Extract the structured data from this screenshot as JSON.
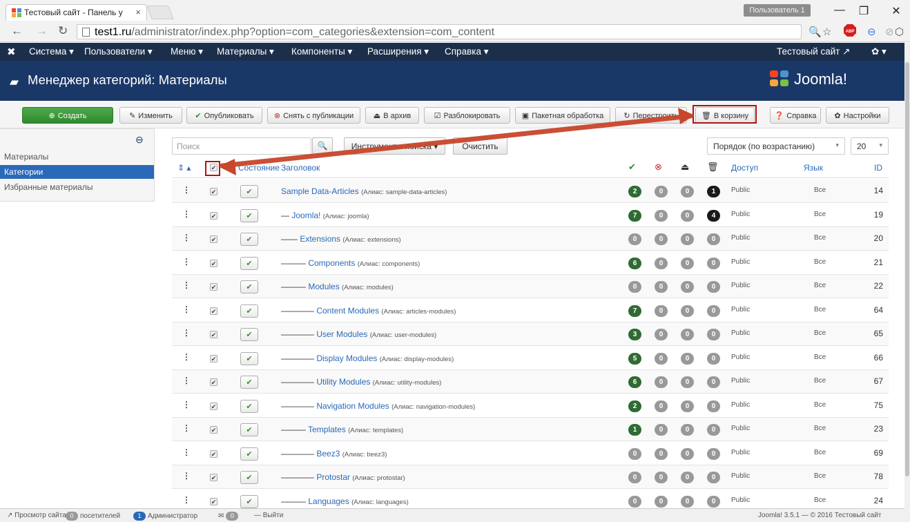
{
  "browser": {
    "tab_title": "Тестовый сайт - Панель у",
    "tab_close": "×",
    "user_badge": "Пользователь 1",
    "window": {
      "minimize": "—",
      "restore": "❐",
      "close": "✕"
    },
    "url_host": "test1.ru",
    "url_path": "/administrator/index.php?option=com_categories&extension=com_content"
  },
  "topnav": {
    "items": [
      "Система ▾",
      "Пользователи ▾",
      "Меню ▾",
      "Материалы ▾",
      "Компоненты ▾",
      "Расширения ▾",
      "Справка ▾"
    ],
    "site_link": "Тестовый сайт ↗",
    "settings": "✿ ▾"
  },
  "header": {
    "title": "Менеджер категорий: Материалы",
    "brand": "Joomla!"
  },
  "toolbar": {
    "create": "Создать",
    "edit": "Изменить",
    "publish": "Опубликовать",
    "unpublish": "Снять с публикации",
    "archive": "В архив",
    "checkin": "Разблокировать",
    "batch": "Пакетная обработка",
    "rebuild": "Перестроить",
    "trash": "В корзину",
    "help": "Справка",
    "options": "Настройки"
  },
  "sidebar": {
    "items": [
      {
        "label": "Материалы",
        "active": false
      },
      {
        "label": "Категории",
        "active": true
      },
      {
        "label": "Избранные материалы",
        "active": false
      }
    ]
  },
  "filters": {
    "search_placeholder": "Поиск",
    "search_tools": "Инструменты поиска ▾",
    "clear": "Очистить",
    "ordering": "Порядок (по возрастанию)",
    "limit": "20"
  },
  "table": {
    "headers": {
      "status": "Состояние",
      "title": "Заголовок",
      "access": "Доступ",
      "language": "Язык",
      "id": "ID"
    },
    "alias_prefix": "Алиас:",
    "rows": [
      {
        "dashes": "",
        "title": "Sample Data-Articles",
        "alias": "sample-data-articles",
        "published": "2",
        "unpublished": "0",
        "archived": "0",
        "trashed": "1",
        "access": "Public",
        "lang": "Все",
        "id": "14"
      },
      {
        "dashes": "—",
        "title": "Joomla!",
        "alias": "joomla",
        "published": "7",
        "unpublished": "0",
        "archived": "0",
        "trashed": "4",
        "access": "Public",
        "lang": "Все",
        "id": "19"
      },
      {
        "dashes": "——",
        "title": "Extensions",
        "alias": "extensions",
        "published": "0",
        "unpublished": "0",
        "archived": "0",
        "trashed": "0",
        "access": "Public",
        "lang": "Все",
        "id": "20"
      },
      {
        "dashes": "———",
        "title": "Components",
        "alias": "components",
        "published": "6",
        "unpublished": "0",
        "archived": "0",
        "trashed": "0",
        "access": "Public",
        "lang": "Все",
        "id": "21"
      },
      {
        "dashes": "———",
        "title": "Modules",
        "alias": "modules",
        "published": "0",
        "unpublished": "0",
        "archived": "0",
        "trashed": "0",
        "access": "Public",
        "lang": "Все",
        "id": "22"
      },
      {
        "dashes": "————",
        "title": "Content Modules",
        "alias": "articles-modules",
        "published": "7",
        "unpublished": "0",
        "archived": "0",
        "trashed": "0",
        "access": "Public",
        "lang": "Все",
        "id": "64"
      },
      {
        "dashes": "————",
        "title": "User Modules",
        "alias": "user-modules",
        "published": "3",
        "unpublished": "0",
        "archived": "0",
        "trashed": "0",
        "access": "Public",
        "lang": "Все",
        "id": "65"
      },
      {
        "dashes": "————",
        "title": "Display Modules",
        "alias": "display-modules",
        "published": "5",
        "unpublished": "0",
        "archived": "0",
        "trashed": "0",
        "access": "Public",
        "lang": "Все",
        "id": "66"
      },
      {
        "dashes": "————",
        "title": "Utility Modules",
        "alias": "utility-modules",
        "published": "6",
        "unpublished": "0",
        "archived": "0",
        "trashed": "0",
        "access": "Public",
        "lang": "Все",
        "id": "67"
      },
      {
        "dashes": "————",
        "title": "Navigation Modules",
        "alias": "navigation-modules",
        "published": "2",
        "unpublished": "0",
        "archived": "0",
        "trashed": "0",
        "access": "Public",
        "lang": "Все",
        "id": "75"
      },
      {
        "dashes": "———",
        "title": "Templates",
        "alias": "templates",
        "published": "1",
        "unpublished": "0",
        "archived": "0",
        "trashed": "0",
        "access": "Public",
        "lang": "Все",
        "id": "23"
      },
      {
        "dashes": "————",
        "title": "Beez3",
        "alias": "beez3",
        "published": "0",
        "unpublished": "0",
        "archived": "0",
        "trashed": "0",
        "access": "Public",
        "lang": "Все",
        "id": "69"
      },
      {
        "dashes": "————",
        "title": "Protostar",
        "alias": "protostar",
        "published": "0",
        "unpublished": "0",
        "archived": "0",
        "trashed": "0",
        "access": "Public",
        "lang": "Все",
        "id": "78"
      },
      {
        "dashes": "———",
        "title": "Languages",
        "alias": "languages",
        "published": "0",
        "unpublished": "0",
        "archived": "0",
        "trashed": "0",
        "access": "Public",
        "lang": "Все",
        "id": "24"
      }
    ]
  },
  "footer": {
    "view_site": "Просмотр сайта",
    "visitors_count": "0",
    "visitors_label": "посетителей",
    "admins_count": "1",
    "admins_label": "Администратор",
    "messages_count": "0",
    "logout": "Выйти",
    "version": "Joomla! 3.5.1 — © 2016 Тестовый сайт"
  },
  "colors": {
    "topnav": "#1c2f4a",
    "header": "#1a3867",
    "link": "#2a69b8",
    "highlight": "#b01212",
    "published_badge": "#2f6b34"
  }
}
